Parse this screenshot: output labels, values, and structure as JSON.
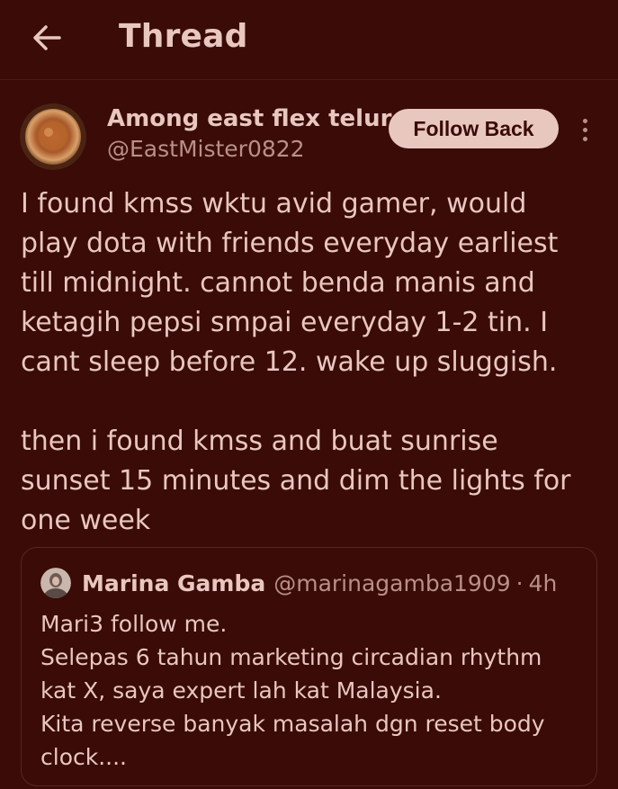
{
  "header": {
    "back_icon": "back-arrow-icon",
    "title": "Thread"
  },
  "tweet": {
    "display_name": "Among east flex telur",
    "handle": "@EastMister0822",
    "follow_label": "Follow Back",
    "more_icon": "more-vertical-icon",
    "paragraphs": [
      [
        "I found kmss wktu avid gamer, would",
        "play dota with friends everyday earliest",
        "till midnight. cannot benda manis and",
        "ketagih pepsi smpai everyday 1-2 tin. I",
        "cant sleep before 12. wake up sluggish."
      ],
      [
        "then i found kmss and buat sunrise",
        "sunset 15 minutes and dim the lights for",
        "one week"
      ]
    ]
  },
  "quote": {
    "display_name": "Marina Gamba",
    "handle": "@marinagamba1909",
    "separator": "·",
    "time": "4h",
    "lines": [
      "Mari3 follow me.",
      "Selepas 6 tahun marketing circadian rhythm",
      "kat X, saya expert lah kat Malaysia.",
      "Kita reverse banyak masalah dgn reset body",
      "clock...."
    ]
  },
  "colors": {
    "background": "#3a0b07",
    "text": "#e8c7bf",
    "muted": "#b89089",
    "button_bg": "#e8c7bf"
  }
}
